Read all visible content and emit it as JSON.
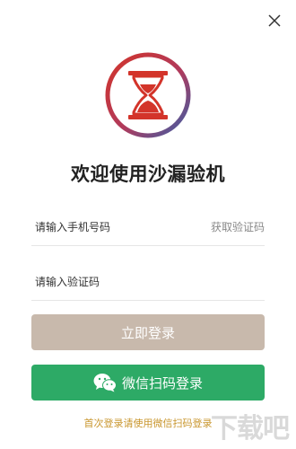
{
  "header": {
    "close_icon": "close-icon",
    "logo_icon": "hourglass-icon"
  },
  "main": {
    "title": "欢迎使用沙漏验机",
    "phone_placeholder": "请输入手机号码",
    "get_code_label": "获取验证码",
    "code_placeholder": "请输入验证码",
    "login_label": "立即登录",
    "wechat_label": "微信扫码登录",
    "tip": "首次登录请使用微信扫码登录"
  },
  "watermark": "下载吧",
  "colors": {
    "brand_red": "#d3342a",
    "ring_gradient_start": "#d3342a",
    "ring_gradient_end": "#3a5fa8",
    "login_button": "#c8b9ac",
    "wechat_button": "#2daa66",
    "tip_text": "#c9962e"
  }
}
